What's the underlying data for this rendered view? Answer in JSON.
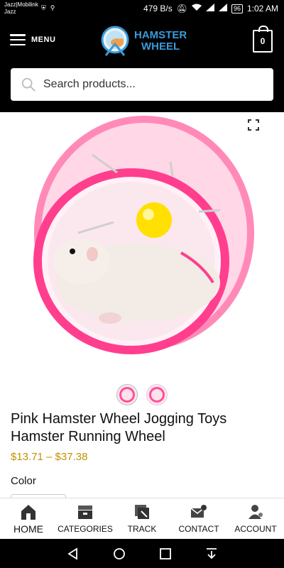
{
  "status_bar": {
    "carrier_line1": "Jazz|Mobilink",
    "carrier_line2": "Jazz",
    "net_speed": "479 B/s",
    "battery": "96",
    "time": "1:02 AM"
  },
  "header": {
    "menu_label": "MENU",
    "logo_line1": "HAMSTER",
    "logo_line2": "WHEEL",
    "cart_count": "0"
  },
  "search": {
    "placeholder": "Search products..."
  },
  "product": {
    "title": "Pink Hamster Wheel Jogging Toys Hamster Running Wheel",
    "price": "$13.71 – $37.38",
    "color_label": "Color"
  },
  "bottom_nav": {
    "items": [
      {
        "label": "HOME",
        "icon": "home-icon"
      },
      {
        "label": "CATEGORIES",
        "icon": "categories-icon"
      },
      {
        "label": "TRACK",
        "icon": "track-icon"
      },
      {
        "label": "CONTACT",
        "icon": "contact-icon"
      },
      {
        "label": "ACCOUNT",
        "icon": "account-icon"
      }
    ]
  },
  "colors": {
    "header_bg": "#000000",
    "price": "#c39000",
    "logo_blue": "#3a9ad9",
    "wheel_pink": "#ff4f9b"
  }
}
